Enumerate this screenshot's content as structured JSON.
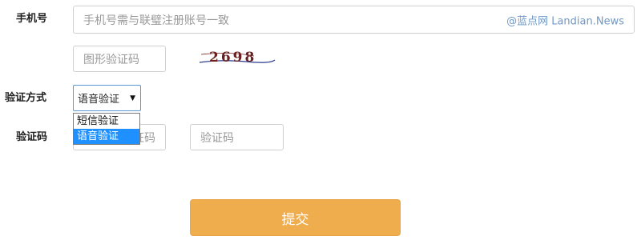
{
  "form": {
    "phone_label": "手机号",
    "phone_placeholder": "手机号需与联璧注册账号一致",
    "watermark": "@蓝点网 Landian.News",
    "captcha_placeholder": "图形验证码",
    "captcha_text": "2698",
    "method_label": "验证方式",
    "method_selected": "语音验证",
    "method_options": [
      "短信验证",
      "语音验证"
    ],
    "code_label": "验证码",
    "code_hidden_placeholder": "验证码",
    "code_placeholder": "验证码",
    "submit_label": "提交"
  },
  "colors": {
    "submit": "#f0ad4e",
    "option_selected": "#1e90ff",
    "watermark": "#6f98c8"
  }
}
